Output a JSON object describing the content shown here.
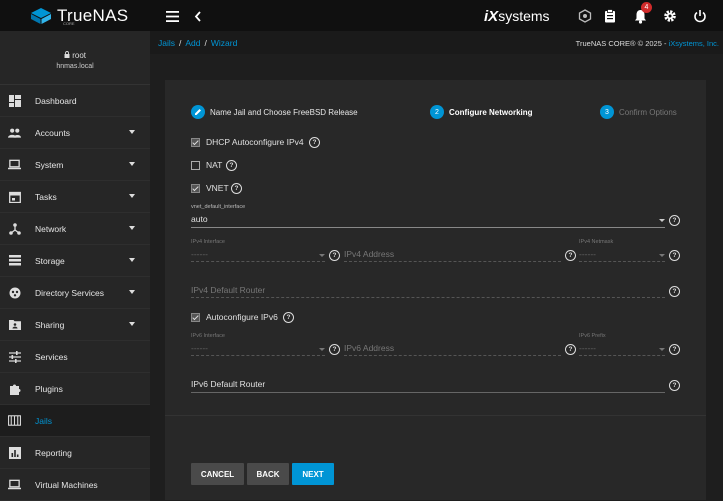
{
  "app": {
    "name": "TrueNAS",
    "edition": "CORE"
  },
  "topbar": {
    "vendor_prefix": "iX",
    "vendor_name": "systems",
    "notification_count": "4"
  },
  "user": {
    "name": "root",
    "host": "hnmas.local"
  },
  "sidebar": {
    "items": [
      {
        "label": "Dashboard",
        "icon": "dashboard-icon",
        "has_children": false
      },
      {
        "label": "Accounts",
        "icon": "people-icon",
        "has_children": true
      },
      {
        "label": "System",
        "icon": "laptop-icon",
        "has_children": true
      },
      {
        "label": "Tasks",
        "icon": "calendar-icon",
        "has_children": true
      },
      {
        "label": "Network",
        "icon": "network-icon",
        "has_children": true
      },
      {
        "label": "Storage",
        "icon": "storage-icon",
        "has_children": true
      },
      {
        "label": "Directory Services",
        "icon": "directory-icon",
        "has_children": true
      },
      {
        "label": "Sharing",
        "icon": "folder-shared-icon",
        "has_children": true
      },
      {
        "label": "Services",
        "icon": "tune-icon",
        "has_children": false
      },
      {
        "label": "Plugins",
        "icon": "extension-icon",
        "has_children": false
      },
      {
        "label": "Jails",
        "icon": "jail-icon",
        "has_children": false,
        "active": true
      },
      {
        "label": "Reporting",
        "icon": "chart-icon",
        "has_children": false
      },
      {
        "label": "Virtual Machines",
        "icon": "computer-icon",
        "has_children": false
      }
    ]
  },
  "breadcrumb": {
    "items": [
      "Jails",
      "Add",
      "Wizard"
    ]
  },
  "copyright": {
    "text": "TrueNAS CORE® © 2025 - ",
    "link": "iXsystems, Inc."
  },
  "stepper": {
    "steps": [
      {
        "label": "Name Jail and Choose FreeBSD Release",
        "marker": "edit-icon",
        "state": "done"
      },
      {
        "label": "Configure Networking",
        "marker": "2",
        "state": "active"
      },
      {
        "label": "Confirm Options",
        "marker": "3",
        "state": "pending"
      }
    ]
  },
  "form": {
    "dhcp": {
      "label": "DHCP Autoconfigure IPv4",
      "checked": true
    },
    "nat": {
      "label": "NAT",
      "checked": false
    },
    "vnet": {
      "label": "VNET",
      "checked": true
    },
    "vnet_default_interface": {
      "label": "vnet_default_interface",
      "value": "auto"
    },
    "ipv4_interface": {
      "label": "IPv4 Interface",
      "value": "------"
    },
    "ipv4_address": {
      "placeholder": "IPv4 Address"
    },
    "ipv4_netmask": {
      "label": "IPv4 Netmask",
      "value": "------"
    },
    "ipv4_default_router": {
      "placeholder": "IPv4 Default Router"
    },
    "autoconfigure_ipv6": {
      "label": "Autoconfigure IPv6",
      "checked": true
    },
    "ipv6_interface": {
      "label": "IPv6 Interface",
      "value": "------"
    },
    "ipv6_address": {
      "placeholder": "IPv6 Address"
    },
    "ipv6_prefix": {
      "label": "IPv6 Prefix",
      "value": "------"
    },
    "ipv6_default_router": {
      "label": "IPv6 Default Router"
    }
  },
  "actions": {
    "cancel": "CANCEL",
    "back": "BACK",
    "next": "NEXT"
  },
  "colors": {
    "accent": "#0095d5",
    "topbar": "#101010",
    "sidebar": "#262626",
    "card": "#282828",
    "badge": "#d12b2b"
  }
}
